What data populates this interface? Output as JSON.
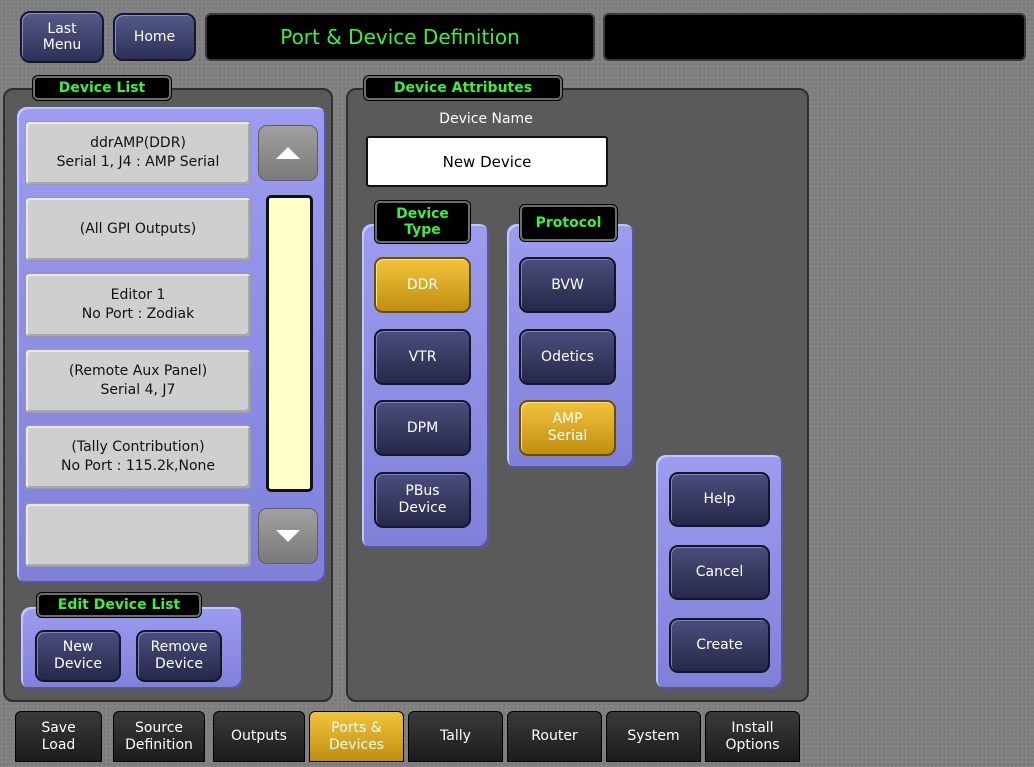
{
  "header": {
    "last_menu_label": "Last\nMenu",
    "home_label": "Home",
    "title": "Port & Device Definition"
  },
  "device_list": {
    "title": "Device List",
    "items": [
      "ddrAMP(DDR)\nSerial 1, J4 : AMP Serial",
      "(All GPI Outputs)",
      "Editor 1\nNo Port : Zodiak",
      "(Remote Aux Panel)\nSerial 4, J7",
      "(Tally Contribution)\nNo Port : 115.2k,None",
      ""
    ],
    "edit_title": "Edit Device List",
    "new_device_label": "New\nDevice",
    "remove_device_label": "Remove\nDevice"
  },
  "device_attributes": {
    "title": "Device Attributes",
    "device_name_label": "Device Name",
    "device_name_value": "New Device",
    "device_type_title": "Device\nType",
    "device_types": [
      {
        "label": "DDR",
        "selected": true
      },
      {
        "label": "VTR",
        "selected": false
      },
      {
        "label": "DPM",
        "selected": false
      },
      {
        "label": "PBus\nDevice",
        "selected": false
      }
    ],
    "protocol_title": "Protocol",
    "protocols": [
      {
        "label": "BVW",
        "selected": false
      },
      {
        "label": "Odetics",
        "selected": false
      },
      {
        "label": "AMP\nSerial",
        "selected": true
      }
    ],
    "help_label": "Help",
    "cancel_label": "Cancel",
    "create_label": "Create"
  },
  "bottom_tabs": [
    {
      "label": "Save\nLoad",
      "active": false
    },
    {
      "label": "Source\nDefinition",
      "active": false
    },
    {
      "label": "Outputs",
      "active": false
    },
    {
      "label": "Ports &\nDevices",
      "active": true
    },
    {
      "label": "Tally",
      "active": false
    },
    {
      "label": "Router",
      "active": false
    },
    {
      "label": "System",
      "active": false
    },
    {
      "label": "Install\nOptions",
      "active": false
    }
  ],
  "colors": {
    "title_text": "#3ef03e",
    "selected_button": "#e0b02a",
    "lavender_group": "#8c8ce4",
    "scroll_track": "#fffec8"
  }
}
